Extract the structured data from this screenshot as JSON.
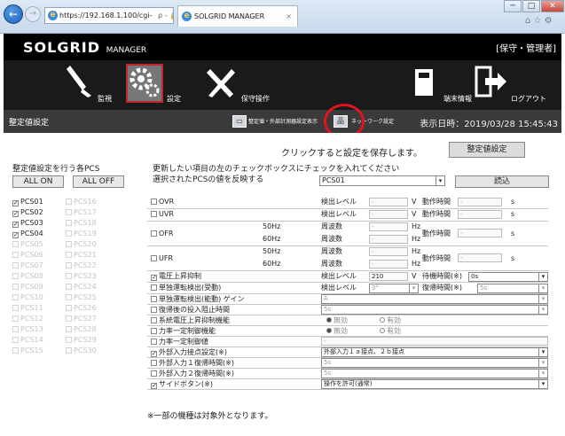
{
  "browser": {
    "url": "https://192.168.1.100/cgi-",
    "url_icons": "ρ - 🔒 C",
    "tab_title": "SOLGRID MANAGER",
    "tab_close": "×",
    "back": "←",
    "forward": "→",
    "min": "─",
    "max": "□",
    "close": "✕",
    "tools": "⌂ ☆ ⚙"
  },
  "header": {
    "logo_main": "SOLGRID",
    "logo_sub": "MANAGER",
    "role": "[保守・管理者]"
  },
  "menu": [
    {
      "label": "監視",
      "icon": "brush-icon"
    },
    {
      "label": "設定",
      "icon": "gear-icon"
    },
    {
      "label": "保守操作",
      "icon": "tools-icon"
    },
    {
      "label": "端末情報",
      "icon": "device-icon"
    },
    {
      "label": "ログアウト",
      "icon": "logout-icon"
    }
  ],
  "subbar": {
    "title": "整定値設定",
    "link1": "整定値・外部計測器設定表示",
    "link2": "ネットワーク設定",
    "datetime": "表示日時：2019/03/28 15:45:43"
  },
  "main": {
    "save_hint": "クリックすると設定を保存します。",
    "save_button": "整定値設定",
    "left_title": "整定値設定を行う各PCS",
    "all_on": "ALL ON",
    "all_off": "ALL OFF",
    "pcs_left": [
      {
        "name": "PCS01",
        "checked": true
      },
      {
        "name": "PCS02",
        "checked": true
      },
      {
        "name": "PCS03",
        "checked": true
      },
      {
        "name": "PCS04",
        "checked": true
      },
      {
        "name": "PCS05",
        "checked": false
      },
      {
        "name": "PCS06",
        "checked": false
      },
      {
        "name": "PCS07",
        "checked": false
      },
      {
        "name": "PCS08",
        "checked": false
      },
      {
        "name": "PCS09",
        "checked": false
      },
      {
        "name": "PCS10",
        "checked": false
      },
      {
        "name": "PCS11",
        "checked": false
      },
      {
        "name": "PCS12",
        "checked": false
      },
      {
        "name": "PCS13",
        "checked": false
      },
      {
        "name": "PCS14",
        "checked": false
      },
      {
        "name": "PCS15",
        "checked": false
      }
    ],
    "pcs_right": [
      "PCS16",
      "PCS17",
      "PCS18",
      "PCS19",
      "PCS20",
      "PCS21",
      "PCS22",
      "PCS23",
      "PCS24",
      "PCS25",
      "PCS26",
      "PCS27",
      "PCS28",
      "PCS29",
      "PCS30"
    ],
    "instruction": "更新したい項目の左のチェックボックスにチェックを入れてください",
    "reflect_label": "選択されたPCSの値を反映する",
    "reflect_value": "PCS01",
    "load_button": "読込",
    "note": "※一部の機種は対象外となります。"
  },
  "rows": {
    "ovr": {
      "name": "OVR",
      "lvl": "検出レベル",
      "val": "-",
      "unit": "V",
      "tlbl": "動作時間",
      "tval": "-",
      "tunit": "s"
    },
    "uvr": {
      "name": "UVR",
      "lvl": "検出レベル",
      "val": "-",
      "unit": "V",
      "tlbl": "動作時間",
      "tval": "-",
      "tunit": "s"
    },
    "ofr": {
      "name": "OFR",
      "hz50": "50Hz",
      "hz60": "60Hz",
      "lbl": "周波数",
      "val": "-",
      "unit": "Hz",
      "tlbl": "動作時間",
      "tval": "-",
      "tunit": "s"
    },
    "ufr": {
      "name": "UFR",
      "hz50": "50Hz",
      "hz60": "60Hz",
      "lbl": "周波数",
      "val": "-",
      "unit": "Hz",
      "tlbl": "動作時間",
      "tval": "-",
      "tunit": "s"
    },
    "vrise": {
      "name": "電圧上昇抑制",
      "lvl": "検出レベル",
      "val": "210",
      "unit": "V",
      "tlbl": "待機時間(※)",
      "tval": "0s"
    },
    "island_passive": {
      "name": "単独運転検出(受動)",
      "lvl": "検出レベル",
      "val": "3°",
      "tlbl": "復帰時間(※)",
      "tval": "5s"
    },
    "island_active": {
      "name": "単独運転検出(能動) ゲイン",
      "val": "A"
    },
    "reconnect": {
      "name": "復帰後の投入阻止時間",
      "val": "5s"
    },
    "sys_vrise": {
      "name": "系統電圧上昇抑制機能",
      "opt1": "無効",
      "opt2": "有効"
    },
    "pf_func": {
      "name": "力率一定制御機能",
      "opt1": "無効",
      "opt2": "有効"
    },
    "pf_val": {
      "name": "力率一定制御値",
      "val": "-"
    },
    "ext_contact": {
      "name": "外部入力接点設定(※)",
      "val": "外部入力１ａ接点、２ｂ接点"
    },
    "ext1": {
      "name": "外部入力１復帰時間(※)",
      "val": "5s"
    },
    "ext2": {
      "name": "外部入力２復帰時間(※)",
      "val": "5s"
    },
    "side": {
      "name": "サイドボタン(※)",
      "val": "操作を許可(通常)"
    }
  }
}
